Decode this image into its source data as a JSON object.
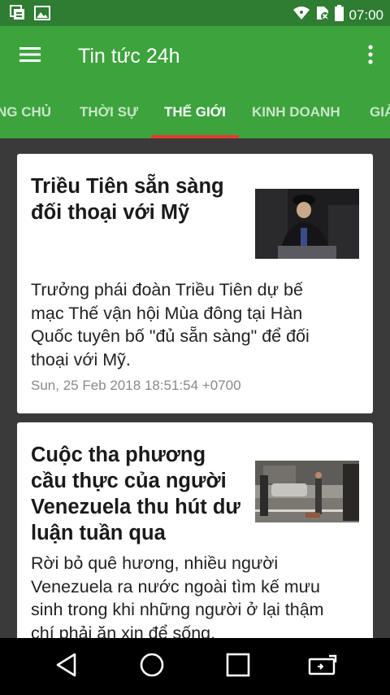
{
  "status_bar": {
    "time": "07:00",
    "icons": [
      "notification-icon",
      "image-icon",
      "wifi-icon",
      "no-sim-icon",
      "battery-icon"
    ]
  },
  "app_bar": {
    "title": "Tin tức 24h",
    "menu_icon": "hamburger-menu-icon",
    "overflow_icon": "more-vert-icon",
    "color": "#3da33d"
  },
  "tabs": [
    {
      "label": "NG CHỦ",
      "active": false
    },
    {
      "label": "THỜI SỰ",
      "active": false
    },
    {
      "label": "THẾ GIỚI",
      "active": true
    },
    {
      "label": "KINH DOANH",
      "active": false
    },
    {
      "label": "GIẢ",
      "active": false
    }
  ],
  "tab_indicator_color": "#e53935",
  "articles": [
    {
      "title_lines": [
        "Triều Tiên sẵn sàng",
        "đối thoại với Mỹ"
      ],
      "summary_lines": [
        "Trưởng phái đoàn Triều Tiên dự bế",
        "mạc Thế vận hội Mùa đông tại Hàn",
        "Quốc tuyên bố \"đủ sẵn sàng\" để đối",
        "thoại với Mỹ."
      ],
      "date": "Sun, 25 Feb 2018 18:51:54 +0700"
    },
    {
      "title_lines": [
        "Cuộc tha phương",
        "cầu thực của người",
        "Venezuela thu hút dư",
        "luận tuần qua"
      ],
      "summary_lines": [
        "Rời bỏ quê hương, nhiều người",
        "Venezuela ra nước ngoài tìm kế mưu",
        "sinh trong khi những người ở lại thậm",
        "chí phải ăn xin để sống."
      ]
    }
  ],
  "nav_bar": {
    "buttons": [
      "back-icon",
      "home-icon",
      "recents-icon",
      "screen-rotate-icon"
    ]
  }
}
